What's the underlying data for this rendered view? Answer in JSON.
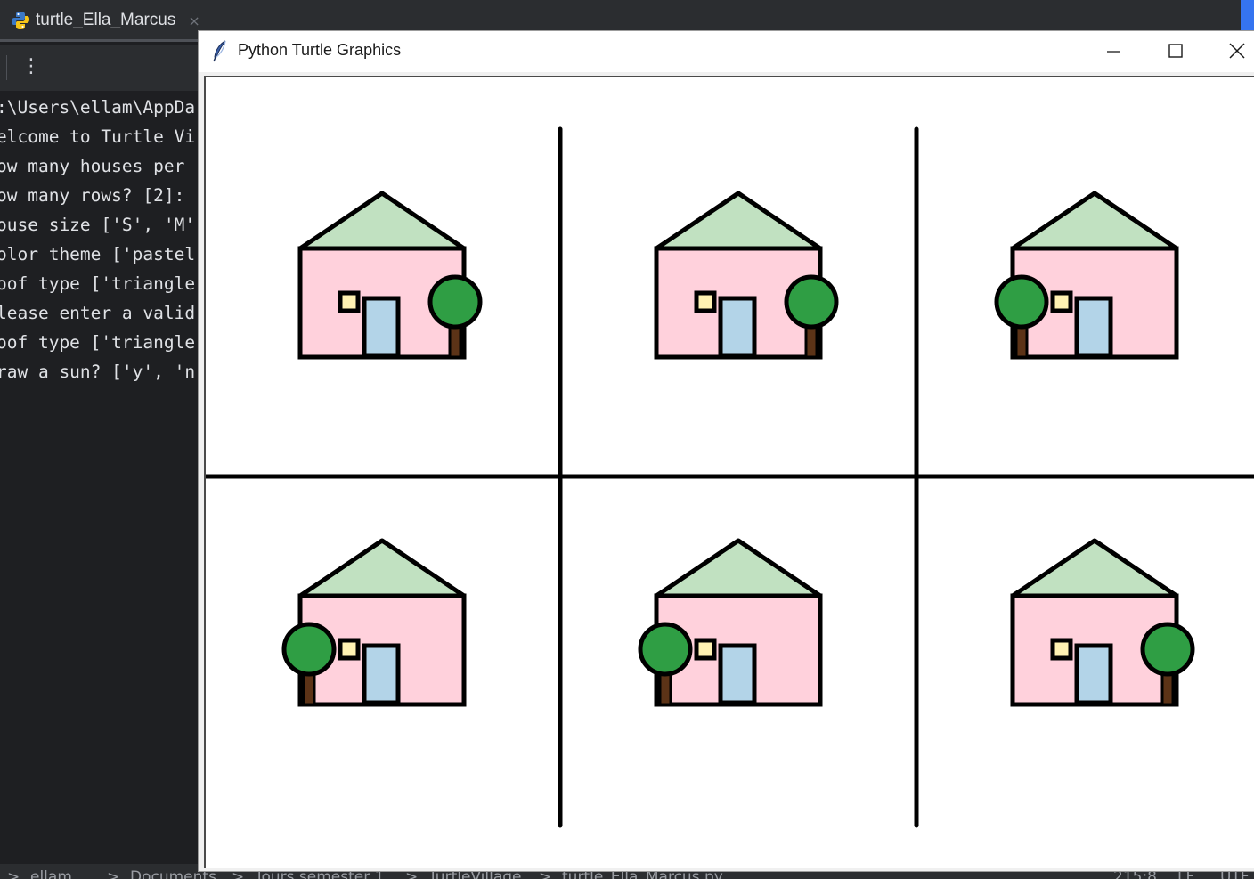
{
  "ide": {
    "tab_title": "turtle_Ella_Marcus",
    "tab_close": "×",
    "more_icon": "⋮",
    "colors": {
      "background": "#1e1f22",
      "panel": "#2b2d30",
      "text": "#dfe1e5",
      "accent": "#3574f0"
    }
  },
  "console": {
    "lines": [
      ":\\Users\\ellam\\AppDa",
      "elcome to Turtle Vi",
      "ow many houses per ",
      "ow many rows? [2]: ",
      "ouse size ['S', 'M'",
      "olor theme ['pastel",
      "oof type ['triangle",
      "lease enter a valid",
      "oof type ['triangle",
      "raw a sun? ['y', 'n"
    ]
  },
  "statusbar": {
    "breadcrumb": [
      "ellam",
      "Documents",
      "Tours semester 1",
      "TurtleVillage",
      "turtle_Ella_Marcus.py"
    ],
    "separator": ">",
    "position": "215:8",
    "line_ending": "LF",
    "encoding": "UTF"
  },
  "turtle_window": {
    "title": "Python Turtle Graphics",
    "icon": "feather-icon",
    "buttons": [
      "minimize-icon",
      "maximize-icon",
      "close-icon"
    ]
  },
  "village": {
    "rows": 2,
    "houses_per_row": 3,
    "colors": {
      "wall": "#ffd1dc",
      "roof": "#c1e1c1",
      "door": "#b3d4e8",
      "window": "#fff2b3",
      "tree_leaves": "#2f9e44",
      "tree_trunk": "#5c3317",
      "outline": "#000000"
    },
    "houses": [
      {
        "tree_side": "right"
      },
      {
        "tree_side": "right"
      },
      {
        "tree_side": "left"
      },
      {
        "tree_side": "left"
      },
      {
        "tree_side": "left"
      },
      {
        "tree_side": "right"
      }
    ]
  }
}
